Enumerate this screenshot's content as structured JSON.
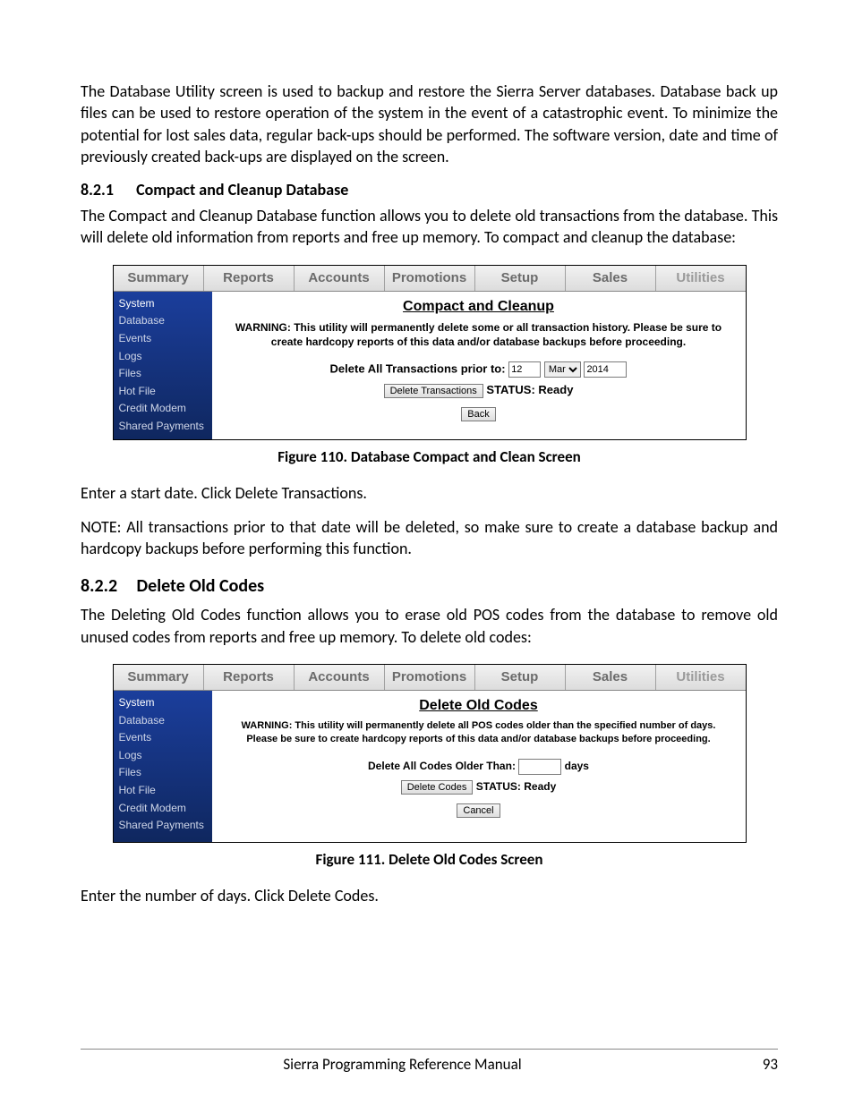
{
  "intro_paragraph": "The Database Utility screen is used to backup and restore the Sierra Server databases. Database back up files can be used to restore operation of the system in the event of a catastrophic event. To minimize the potential for lost sales data, regular back-ups should be performed. The software version, date and time of previously created back-ups are displayed on the screen.",
  "section_821": {
    "number": "8.2.1",
    "title": "Compact and Cleanup Database",
    "paragraph": "The Compact and Cleanup Database function allows you to delete old transactions from the database. This will delete old information from reports and free up memory. To compact and cleanup the database:"
  },
  "figure110": {
    "tabs": [
      "Summary",
      "Reports",
      "Accounts",
      "Promotions",
      "Setup",
      "Sales",
      "Utilities"
    ],
    "sidebar": [
      "System",
      "Database",
      "Events",
      "Logs",
      "Files",
      "Hot File",
      "Credit Modem",
      "Shared Payments"
    ],
    "title": "Compact and Cleanup",
    "warning": "WARNING: This utility will permanently delete some or all transaction history. Please be sure to create hardcopy reports of this data and/or database backups before proceeding.",
    "form_label": "Delete All Transactions prior to:",
    "day_value": "12",
    "month_value": "Mar",
    "year_value": "2014",
    "delete_btn": "Delete Transactions",
    "status_label": "STATUS: Ready",
    "back_btn": "Back",
    "caption": "Figure 110. Database Compact and Clean Screen"
  },
  "after_fig110": {
    "line1": "Enter a start date. Click Delete Transactions.",
    "line2": "NOTE:  All transactions prior to that date will be deleted, so make sure to create a database backup and hardcopy backups before performing this function."
  },
  "section_822": {
    "number": "8.2.2",
    "title": "Delete Old Codes",
    "paragraph": "The Deleting Old Codes function allows you to erase old POS codes from the database to remove old unused codes from reports and free up memory. To delete old codes:"
  },
  "figure111": {
    "tabs": [
      "Summary",
      "Reports",
      "Accounts",
      "Promotions",
      "Setup",
      "Sales",
      "Utilities"
    ],
    "sidebar": [
      "System",
      "Database",
      "Events",
      "Logs",
      "Files",
      "Hot File",
      "Credit Modem",
      "Shared Payments"
    ],
    "title": "Delete Old Codes",
    "warning": "WARNING: This utility will permanently delete all POS codes older than the specified number of days. Please be sure to create hardcopy reports of this data and/or database backups before proceeding.",
    "form_label": "Delete All Codes Older Than:",
    "days_suffix": "days",
    "delete_btn": "Delete Codes",
    "status_label": "STATUS:  Ready",
    "cancel_btn": "Cancel",
    "caption": "Figure 111. Delete Old Codes Screen"
  },
  "after_fig111": "Enter the number of days. Click Delete Codes.",
  "footer": {
    "title": "Sierra Programming Reference Manual",
    "page": "93"
  }
}
